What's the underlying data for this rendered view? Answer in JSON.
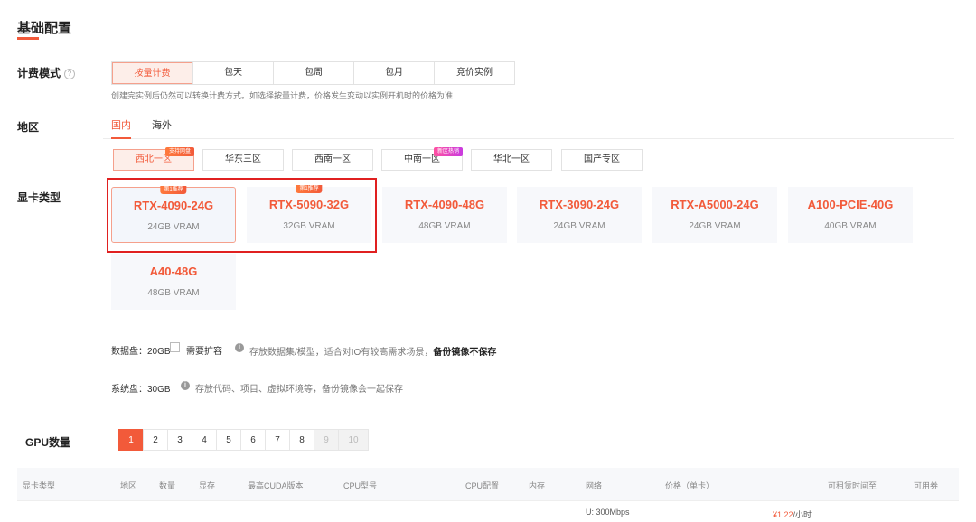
{
  "section_title": "基础配置",
  "billing": {
    "label": "计费模式",
    "help_icon": "?",
    "options": [
      "按量计费",
      "包天",
      "包周",
      "包月",
      "竞价实例"
    ],
    "selected": "按量计费",
    "hint": "创建完实例后仍然可以转换计费方式。如选择按量计费，价格发生变动以实例开机时的价格为准"
  },
  "region": {
    "label": "地区",
    "tabs": [
      "国内",
      "海外"
    ],
    "active_tab": "国内",
    "zones": [
      {
        "name": "西北一区",
        "badge": "支持网盘",
        "badge_color": "#f25a3a"
      },
      {
        "name": "华东三区",
        "badge": "",
        "badge_color": ""
      },
      {
        "name": "西南一区",
        "badge": "",
        "badge_color": ""
      },
      {
        "name": "中南一区",
        "badge": "新区热销",
        "badge_color": "#c93be0"
      },
      {
        "name": "华北一区",
        "badge": "",
        "badge_color": ""
      },
      {
        "name": "国产专区",
        "badge": "",
        "badge_color": ""
      }
    ],
    "selected_zone": "西北一区"
  },
  "gpu": {
    "label": "显卡类型",
    "cards": [
      {
        "name": "RTX-4090-24G",
        "vram": "24GB VRAM",
        "badge": "第1推荐"
      },
      {
        "name": "RTX-5090-32G",
        "vram": "32GB VRAM",
        "badge": "第1推荐"
      },
      {
        "name": "RTX-4090-48G",
        "vram": "48GB VRAM",
        "badge": ""
      },
      {
        "name": "RTX-3090-24G",
        "vram": "24GB VRAM",
        "badge": ""
      },
      {
        "name": "RTX-A5000-24G",
        "vram": "24GB VRAM",
        "badge": ""
      },
      {
        "name": "A100-PCIE-40G",
        "vram": "40GB VRAM",
        "badge": ""
      },
      {
        "name": "A40-48G",
        "vram": "48GB VRAM",
        "badge": ""
      }
    ],
    "selected": "RTX-4090-24G"
  },
  "disks": {
    "data_disk": "数据盘：20GB",
    "expand_label": "需要扩容",
    "data_info": "存放数据集/模型，适合对IO有较高需求场景，",
    "data_info_strong": "备份镜像不保存",
    "system_disk": "系统盘：30GB",
    "system_info": "存放代码、项目、虚拟环境等，备份镜像会一起保存"
  },
  "gpu_count": {
    "label": "GPU数量",
    "pages": [
      "1",
      "2",
      "3",
      "4",
      "5",
      "6",
      "7",
      "8",
      "9",
      "10"
    ],
    "selected": "1",
    "disabled": [
      "9",
      "10"
    ]
  },
  "table": {
    "headers": [
      "显卡类型",
      "地区",
      "数量",
      "显存",
      "最高CUDA版本",
      "CPU型号",
      "CPU配置",
      "内存",
      "网络",
      "价格（单卡）",
      "可租赁时间至",
      "可用券"
    ],
    "row_partial": {
      "network": "U: 300Mbps",
      "price_symbol": "¥",
      "price": "1.22",
      "price_unit": "/小时"
    }
  },
  "colors": {
    "accent": "#f25a3a",
    "selected_bg": "#fdeee9",
    "highlight_border": "#e02020"
  }
}
